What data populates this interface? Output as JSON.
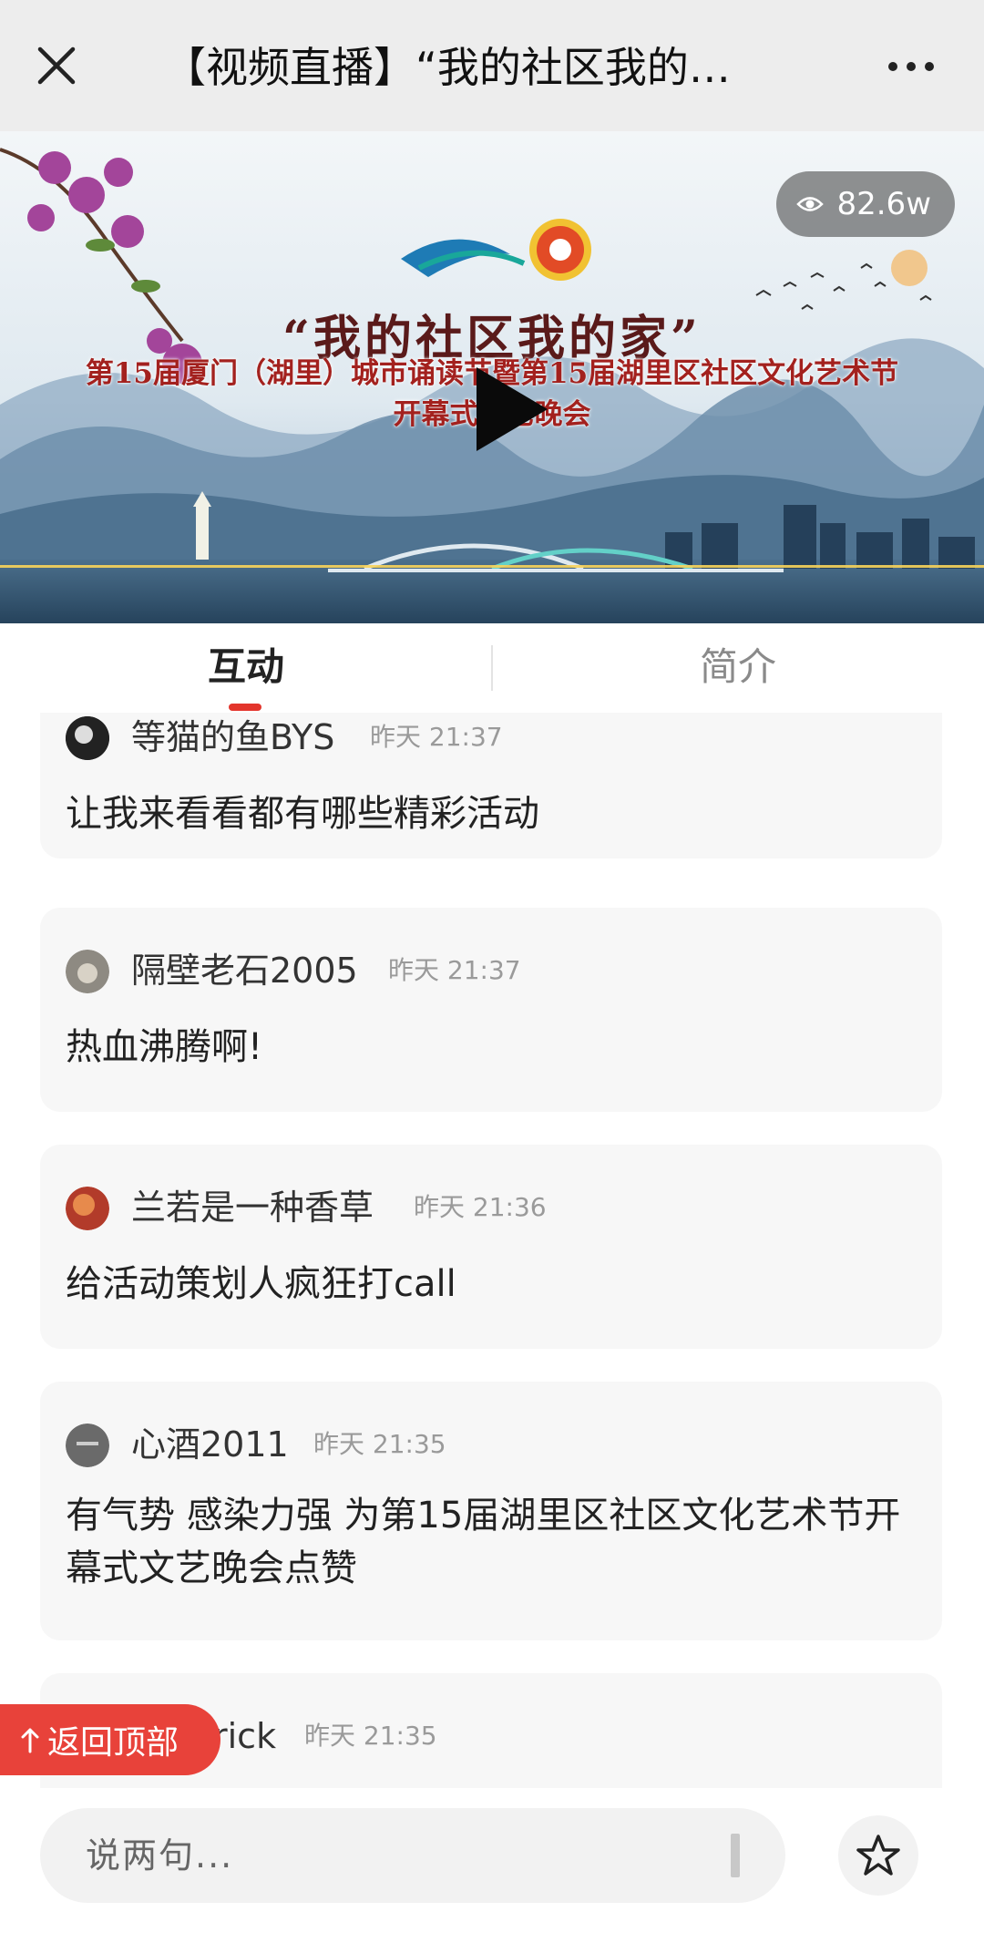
{
  "header": {
    "title": "【视频直播】“我的社区我的…",
    "close_icon": "close-icon",
    "more_icon": "more-icon"
  },
  "video": {
    "views": "82.6w",
    "banner_title": "“我的社区我的家”",
    "banner_line1": "第15届厦门（湖里）城市诵读节暨第15届湖里区社区文化艺术节",
    "banner_line2": "开幕式文艺晚会"
  },
  "tabs": [
    {
      "label": "互动",
      "active": true
    },
    {
      "label": "简介",
      "active": false
    }
  ],
  "comments": [
    {
      "user": "等猫的鱼BYS",
      "time": "昨天 21:37",
      "text": "让我来看看都有哪些精彩活动"
    },
    {
      "user": "隔壁老石2005",
      "time": "昨天 21:37",
      "text": "热血沸腾啊!"
    },
    {
      "user": "兰若是一种香草",
      "time": "昨天 21:36",
      "text": "给活动策划人疯狂打call"
    },
    {
      "user": "心酒2011",
      "time": "昨天 21:35",
      "text": "有气势 感染力强 为第15届湖里区社区文化艺术节开幕式文艺晚会点赞"
    },
    {
      "user": "rick",
      "time": "昨天 21:35",
      "text": ""
    }
  ],
  "back_to_top": "返回顶部",
  "input": {
    "placeholder": "说两句..."
  },
  "colors": {
    "accent": "#e8423a",
    "card_bg": "#f7f7f7"
  }
}
